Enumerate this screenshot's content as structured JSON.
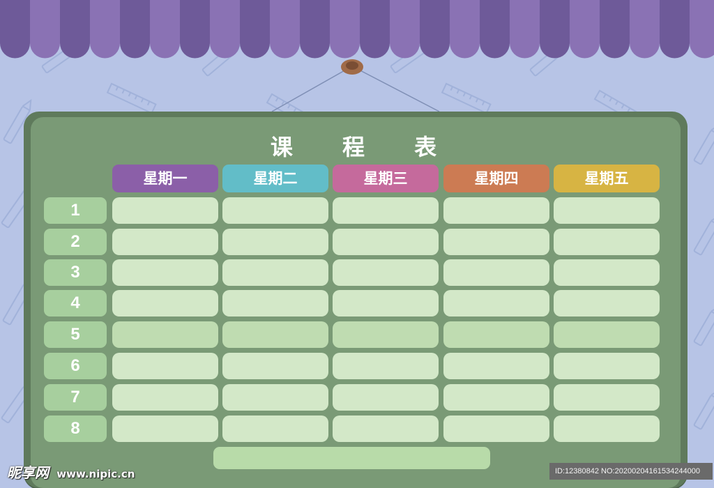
{
  "title": "课 程 表",
  "days": [
    {
      "label": "星期一",
      "color": "#8b5fa8"
    },
    {
      "label": "星期二",
      "color": "#62bdc8"
    },
    {
      "label": "星期三",
      "color": "#c56a9c"
    },
    {
      "label": "星期四",
      "color": "#cc7b53"
    },
    {
      "label": "星期五",
      "color": "#d7b443"
    }
  ],
  "periods": [
    "1",
    "2",
    "3",
    "4",
    "5",
    "6",
    "7",
    "8"
  ],
  "colors": {
    "background": "#b7c4e6",
    "awning": "#8a72b4",
    "board": "#7a9a76",
    "cell": "#d3e8c8",
    "period_badge": "#a7cf9e"
  },
  "watermark": {
    "logo": "昵享网",
    "site": "www.nipic.cn",
    "id_text": "ID:12380842 NO:20200204161534244000"
  }
}
